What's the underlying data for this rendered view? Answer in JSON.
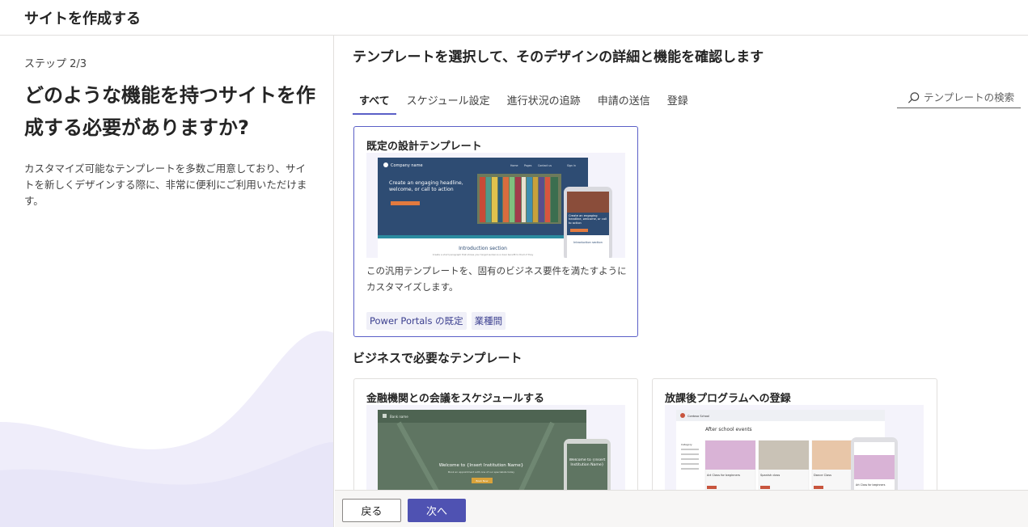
{
  "header": {
    "title": "サイトを作成する"
  },
  "left": {
    "step": "ステップ 2/3",
    "question": "どのような機能を持つサイトを作成する必要がありますか?",
    "description": "カスタマイズ可能なテンプレートを多数ご用意しており、サイトを新しくデザインする際に、非常に便利にご利用いただけます。"
  },
  "main": {
    "title": "テンプレートを選択して、そのデザインの詳細と機能を確認します",
    "tabs": [
      "すべて",
      "スケジュール設定",
      "進行状況の追跡",
      "申請の送信",
      "登録"
    ],
    "search_placeholder": "テンプレートの検索",
    "featured": {
      "title": "既定の設計テンプレート",
      "description": "この汎用テンプレートを、固有のビジネス要件を満たすようにカスタマイズします。",
      "tags": [
        "Power Portals の既定",
        "業種間"
      ],
      "preview": {
        "company": "Company name",
        "nav": [
          "Home",
          "Pages",
          "Contact us",
          "Sign in"
        ],
        "headline": "Create an engaging headline, welcome, or call to action",
        "mobile_headline": "Create an engaging headline, welcome, or call to action",
        "section": "Introduction section",
        "section_text": "Create a short paragraph that shows your target audience a clear benefit to them if they",
        "mobile_section": "Introduction section"
      }
    },
    "section_title": "ビジネスで必要なテンプレート",
    "cards": [
      {
        "title": "金融機関との会議をスケジュールする",
        "preview": {
          "bank": "Bank name",
          "welcome": "Welcome to {Insert Institution Name}",
          "sub": "Book an appointment with one of our specialists today",
          "button": "Book Now",
          "mobile_welcome": "Welcome to {Insert Institution Name}"
        }
      },
      {
        "title": "放課後プログラムへの登録",
        "preview": {
          "school": "Contoso School",
          "heading": "After school events",
          "category": "Category",
          "items": [
            "Art Class for beginners",
            "Spanish class",
            "Dance Class"
          ],
          "mobile_item": "Art Class for beginners"
        }
      }
    ]
  },
  "footer": {
    "back_label": "戻る",
    "next_label": "次へ"
  },
  "colors": {
    "accent": "#5b5fc7",
    "primary_button": "#4f52b2",
    "tag_bg": "#f0f0f8"
  }
}
